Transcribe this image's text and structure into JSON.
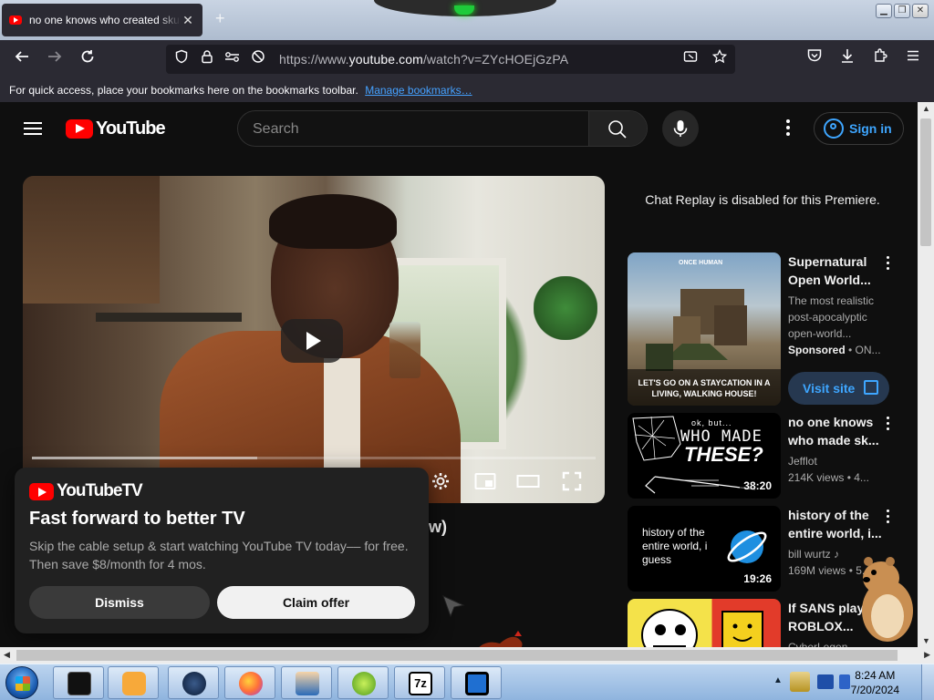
{
  "browser": {
    "tab_title": "no one knows who created skull",
    "tab_close": "✕",
    "new_tab": "+",
    "url_prefix": "https://www.",
    "url_host": "youtube.com",
    "url_path": "/watch?v=ZYcHOEjGzPA",
    "bookmarks_text": "For quick access, place your bookmarks here on the bookmarks toolbar.",
    "bookmarks_link": "Manage bookmarks…"
  },
  "youtube": {
    "logo_text": "YouTube",
    "search_placeholder": "Search",
    "sign_in": "Sign in",
    "video_title_fragment": "w)",
    "chat_replay": "Chat Replay is disabled for this Premiere."
  },
  "promo": {
    "logo_text": "YouTubeTV",
    "headline": "Fast forward to better TV",
    "body": "Skip the cable setup & start watching YouTube TV today–– for free. Then save $8/month for 4 mos.",
    "dismiss": "Dismiss",
    "claim": "Claim offer"
  },
  "recommendations": [
    {
      "title": "Supernatural Open World...",
      "line1": "The most realistic post-apocalyptic open-world...",
      "sponsored": "Sponsored",
      "channel": " • ON...",
      "visit": "Visit site",
      "thumb_brand": "ONCE HUMAN",
      "thumb_caption": "LET'S GO ON A STAYCATION IN A LIVING, WALKING HOUSE!"
    },
    {
      "title": "no one knows who made sk...",
      "channel": "Jefflot",
      "stats": "214K views • 4...",
      "duration": "38:20",
      "thumb_small": "ok, but...",
      "thumb_big1": "WHO MADE",
      "thumb_big2": "THESE?"
    },
    {
      "title": "history of the entire world, i...",
      "channel": "bill wurtz ♪",
      "stats": "169M views • 5...",
      "duration": "19:26",
      "thumb_text": "history of the entire world, i guess"
    },
    {
      "title": "If SANS played ROBLOX...",
      "channel": "CyberLegen..."
    }
  ],
  "taskbar": {
    "time": "8:24 AM",
    "date": "7/20/2024",
    "items": [
      "terminal",
      "media-player",
      "firefox-dark",
      "firefox",
      "contacts",
      "lime",
      "7zip",
      "remote-desktop"
    ]
  },
  "colors": {
    "yt_red": "#ff0000",
    "link_blue": "#3ea6ff",
    "page_bg": "#0f0f0f"
  }
}
